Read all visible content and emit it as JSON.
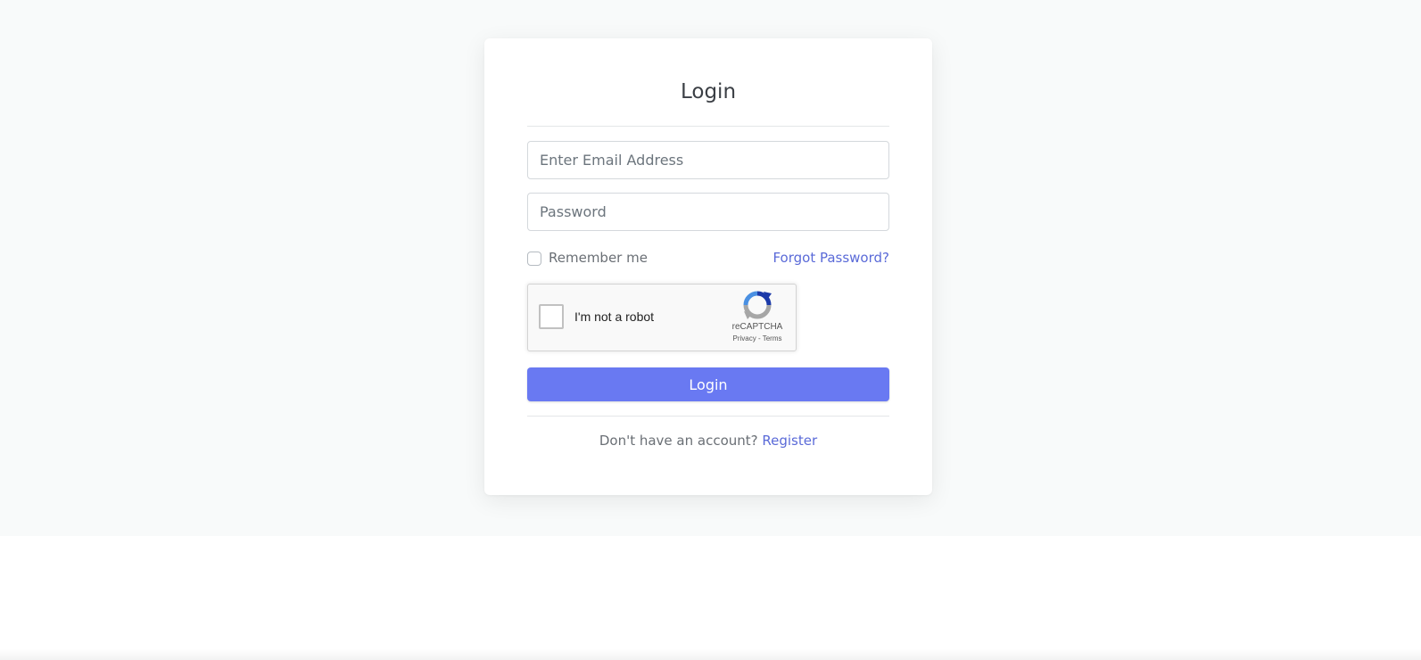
{
  "login_form": {
    "title": "Login",
    "email_placeholder": "Enter Email Address",
    "email_value": "",
    "password_placeholder": "Password",
    "password_value": "",
    "remember_label": "Remember me",
    "remember_checked": false,
    "forgot_label": "Forgot Password?",
    "submit_label": "Login",
    "register_prompt": "Don't have an account?",
    "register_label": "Register"
  },
  "recaptcha": {
    "label": "I'm not a robot",
    "brand": "reCAPTCHA",
    "links": "Privacy - Terms",
    "checked": false
  },
  "colors": {
    "primary": "#6979f2",
    "link": "#5a6ad8",
    "page_background": "#f8fafa",
    "card_background": "#ffffff"
  }
}
